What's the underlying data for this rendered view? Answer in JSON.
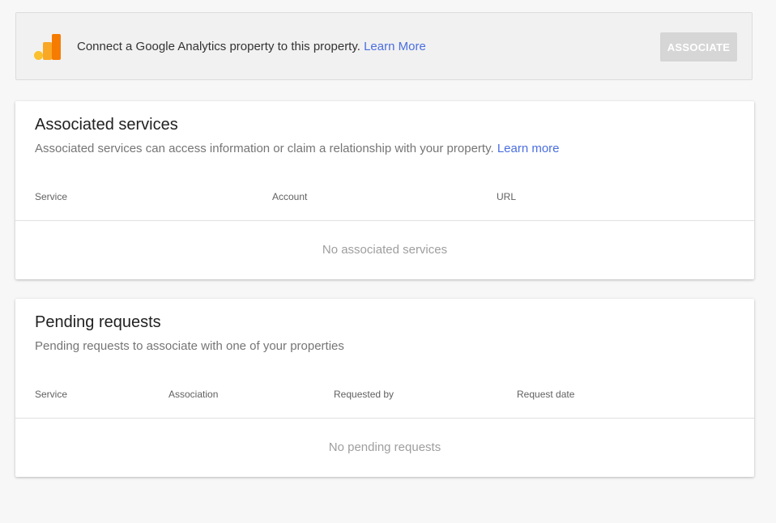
{
  "banner": {
    "text": "Connect a Google Analytics property to this property.",
    "link_label": "Learn More",
    "button_label": "ASSOCIATE",
    "icon": "google-analytics-icon"
  },
  "associated_services": {
    "title": "Associated services",
    "subtitle": "Associated services can access information or claim a relationship with your property.",
    "link_label": "Learn more",
    "columns": [
      "Service",
      "Account",
      "URL"
    ],
    "empty_text": "No associated services"
  },
  "pending_requests": {
    "title": "Pending requests",
    "subtitle": "Pending requests to associate with one of your properties",
    "columns": [
      "Service",
      "Association",
      "Requested by",
      "Request date"
    ],
    "empty_text": "No pending requests"
  },
  "colors": {
    "link": "#4a6ee0",
    "ga_orange": "#f57c00",
    "ga_yellow": "#fbc02d",
    "button_disabled": "#d6d6d6"
  }
}
